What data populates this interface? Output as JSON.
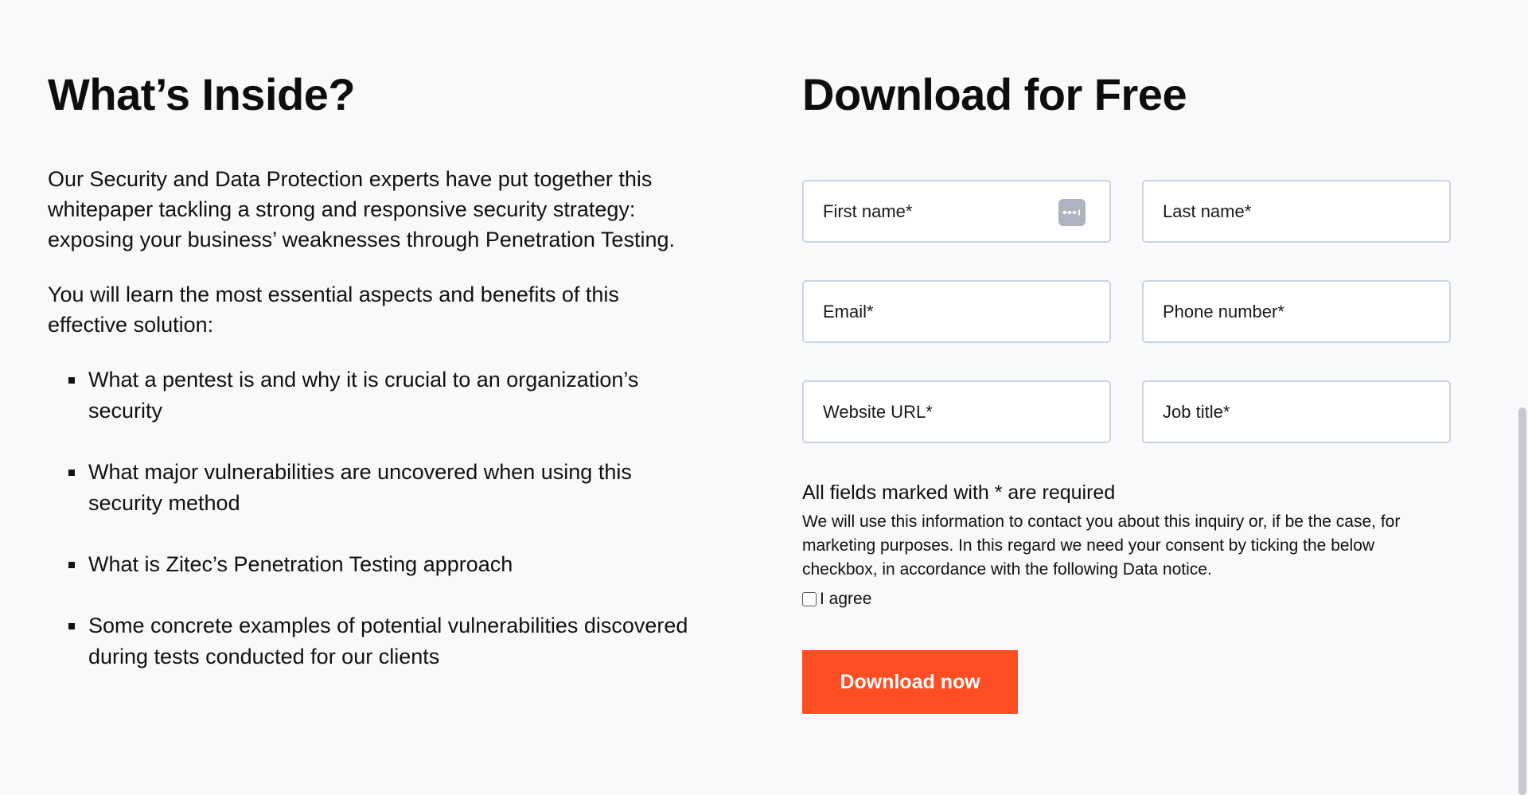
{
  "left": {
    "title": "What’s Inside?",
    "paragraph1": "Our Security and Data Protection experts have put together this whitepaper tackling a strong and responsive security strategy: exposing your business’ weaknesses through Penetration Testing.",
    "paragraph2": "You will learn the most essential aspects and benefits of this effective solution:",
    "bullets": [
      "What a pentest is and why it is crucial to an organization’s security",
      "What major vulnerabilities are uncovered when using this security method",
      "What is Zitec’s Penetration Testing approach",
      "Some concrete examples of potential vulnerabilities discovered during tests conducted for our clients"
    ]
  },
  "right": {
    "title": "Download for Free",
    "fields": {
      "first_name": "First name*",
      "last_name": "Last name*",
      "email": "Email*",
      "phone": "Phone number*",
      "website": "Website URL*",
      "job_title": "Job title*"
    },
    "required_note": "All fields marked with * are required",
    "notice": "We will use this information to contact you about this inquiry or, if be the case, for marketing purposes. In this regard we need your consent by ticking the below checkbox, in accordance with the following Data notice.",
    "agree_label": "I agree",
    "cta_label": "Download now"
  },
  "colors": {
    "accent": "#ff4d24",
    "background": "#f9f9fb",
    "field_border": "#c9d4e0"
  },
  "icons": {
    "password_manager": "password-manager-icon"
  }
}
